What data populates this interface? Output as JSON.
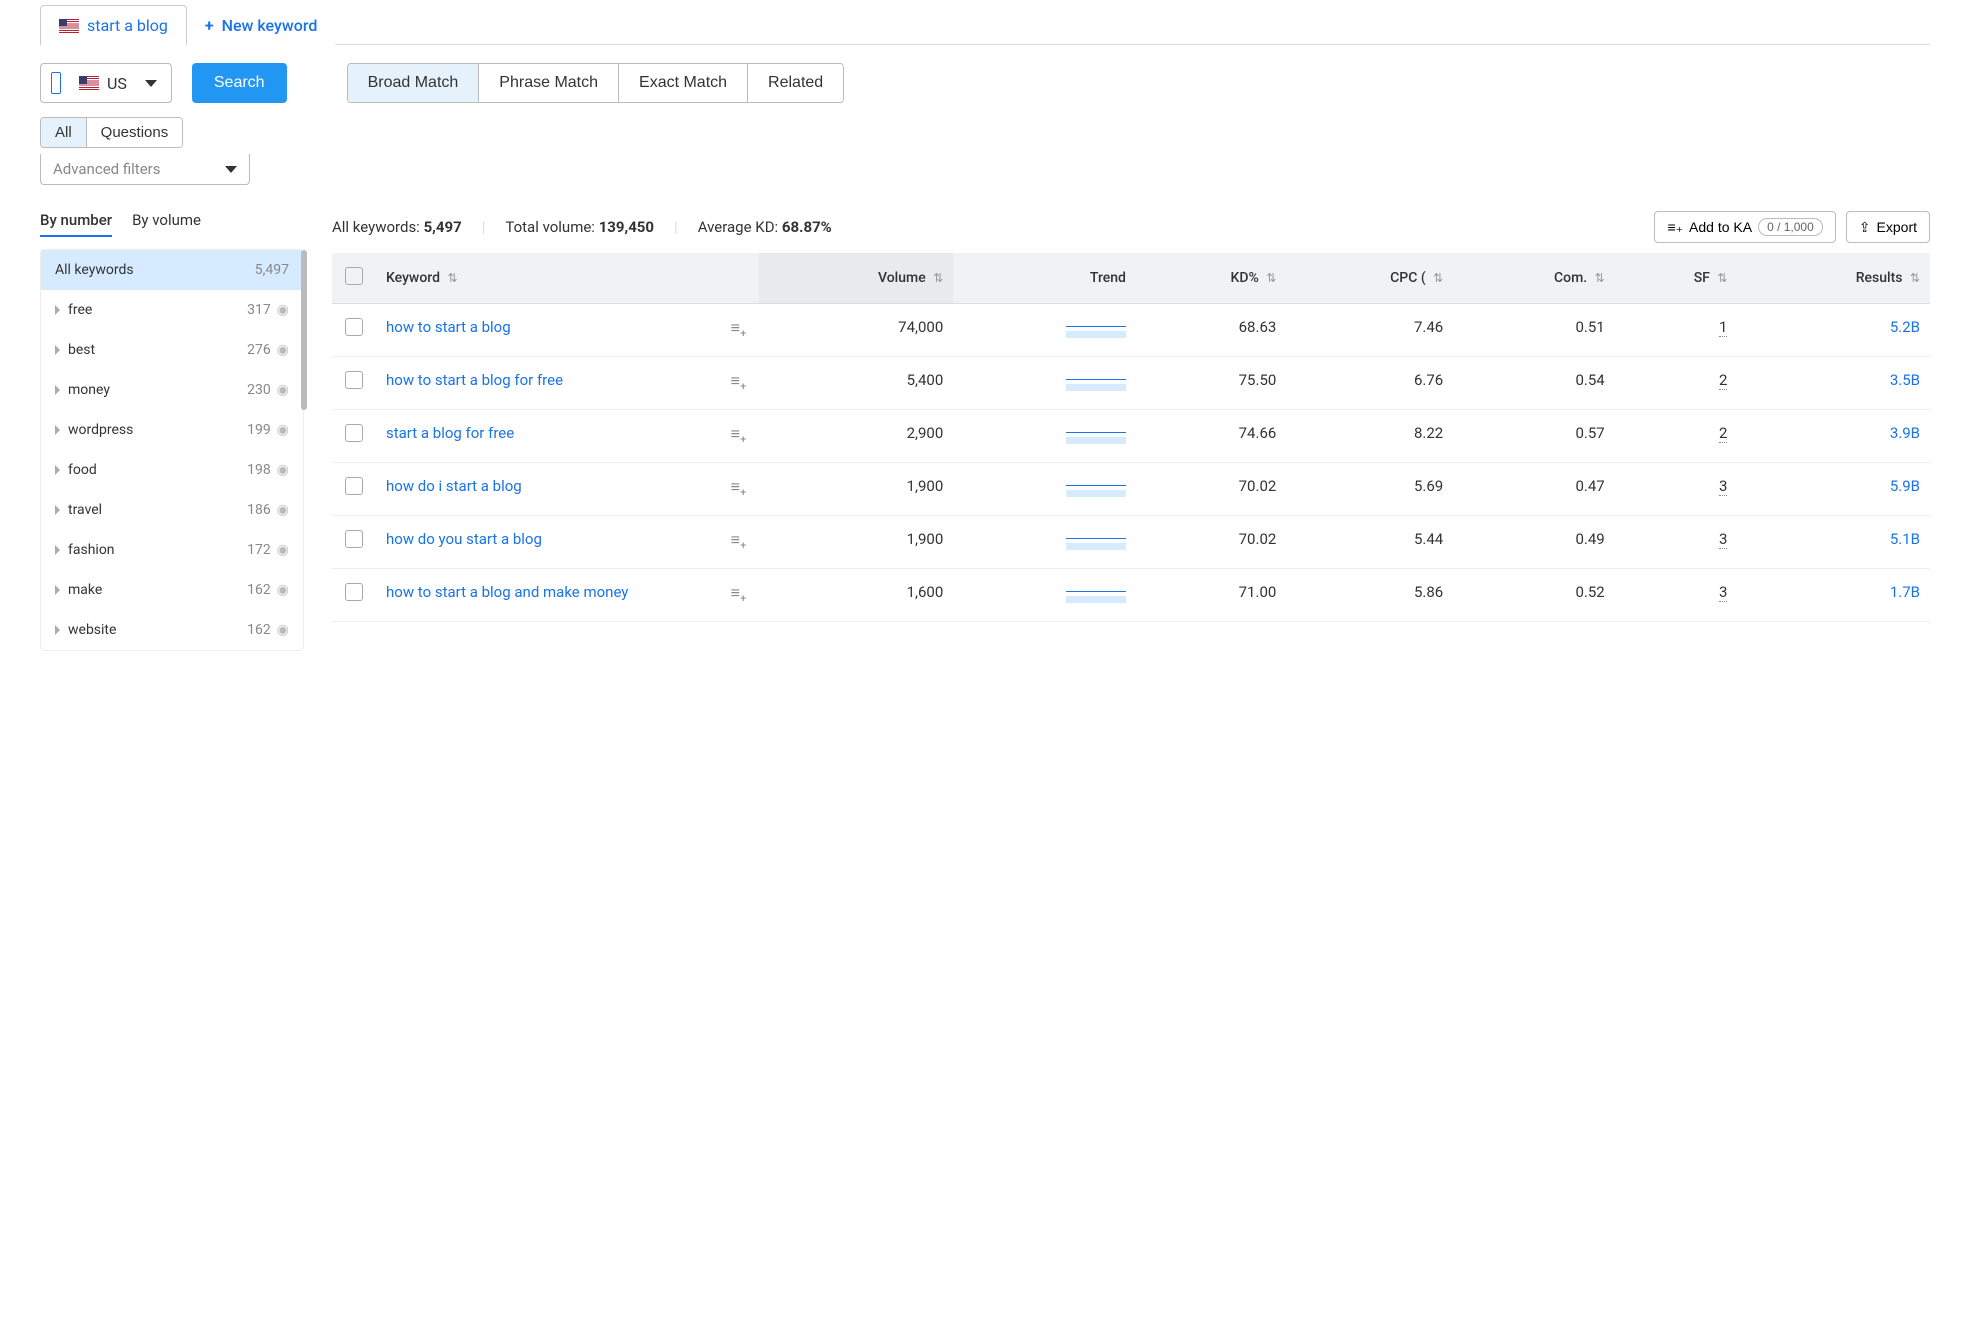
{
  "tabs": {
    "keyword_tab": "start a blog",
    "new_keyword": "New keyword"
  },
  "search_bar": {
    "country": "US",
    "search_button": "Search",
    "match_types": {
      "broad": "Broad Match",
      "phrase": "Phrase Match",
      "exact": "Exact Match",
      "related": "Related"
    }
  },
  "filters": {
    "all": "All",
    "questions": "Questions",
    "advanced": "Advanced filters"
  },
  "left_panel": {
    "sort_by_number": "By number",
    "sort_by_volume": "By volume",
    "all_keywords_label": "All keywords",
    "all_keywords_count": "5,497",
    "groups": [
      {
        "label": "free",
        "count": "317"
      },
      {
        "label": "best",
        "count": "276"
      },
      {
        "label": "money",
        "count": "230"
      },
      {
        "label": "wordpress",
        "count": "199"
      },
      {
        "label": "food",
        "count": "198"
      },
      {
        "label": "travel",
        "count": "186"
      },
      {
        "label": "fashion",
        "count": "172"
      },
      {
        "label": "make",
        "count": "162"
      },
      {
        "label": "website",
        "count": "162"
      }
    ]
  },
  "summary": {
    "all_keywords_label": "All keywords:",
    "all_keywords_value": "5,497",
    "total_volume_label": "Total volume:",
    "total_volume_value": "139,450",
    "avg_kd_label": "Average KD:",
    "avg_kd_value": "68.87%",
    "add_to_ka": "Add to KA",
    "ka_badge": "0 / 1,000",
    "export": "Export"
  },
  "table": {
    "headers": {
      "keyword": "Keyword",
      "volume": "Volume",
      "trend": "Trend",
      "kd": "KD%",
      "cpc": "CPC (",
      "com": "Com.",
      "sf": "SF",
      "results": "Results"
    },
    "rows": [
      {
        "keyword": "how to start a blog",
        "volume": "74,000",
        "kd": "68.63",
        "cpc": "7.46",
        "com": "0.51",
        "sf": "1",
        "results": "5.2B"
      },
      {
        "keyword": "how to start a blog for free",
        "volume": "5,400",
        "kd": "75.50",
        "cpc": "6.76",
        "com": "0.54",
        "sf": "2",
        "results": "3.5B"
      },
      {
        "keyword": "start a blog for free",
        "volume": "2,900",
        "kd": "74.66",
        "cpc": "8.22",
        "com": "0.57",
        "sf": "2",
        "results": "3.9B"
      },
      {
        "keyword": "how do i start a blog",
        "volume": "1,900",
        "kd": "70.02",
        "cpc": "5.69",
        "com": "0.47",
        "sf": "3",
        "results": "5.9B"
      },
      {
        "keyword": "how do you start a blog",
        "volume": "1,900",
        "kd": "70.02",
        "cpc": "5.44",
        "com": "0.49",
        "sf": "3",
        "results": "5.1B"
      },
      {
        "keyword": "how to start a blog and make money",
        "volume": "1,600",
        "kd": "71.00",
        "cpc": "5.86",
        "com": "0.52",
        "sf": "3",
        "results": "1.7B"
      }
    ]
  }
}
